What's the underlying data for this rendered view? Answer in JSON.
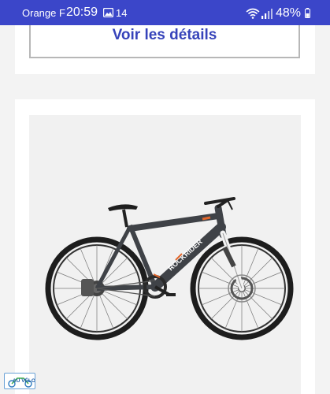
{
  "status_bar": {
    "carrier": "Orange F",
    "time": "20:59",
    "notification_count": "14",
    "battery_percent": "48%",
    "icons": [
      "gallery-icon",
      "wifi-icon",
      "signal-icon",
      "battery-icon"
    ]
  },
  "details": {
    "button_label": "Voir les détails"
  },
  "product": {
    "image": "mountain-bike",
    "frame_text": "ROCKRIDER"
  },
  "badge": {
    "text": "AU VÉLO"
  },
  "colors": {
    "status_bar": "#3b46c9",
    "accent_blue": "#3643ba",
    "bike_frame": "#3f4247",
    "bike_accent": "#e2672c"
  }
}
